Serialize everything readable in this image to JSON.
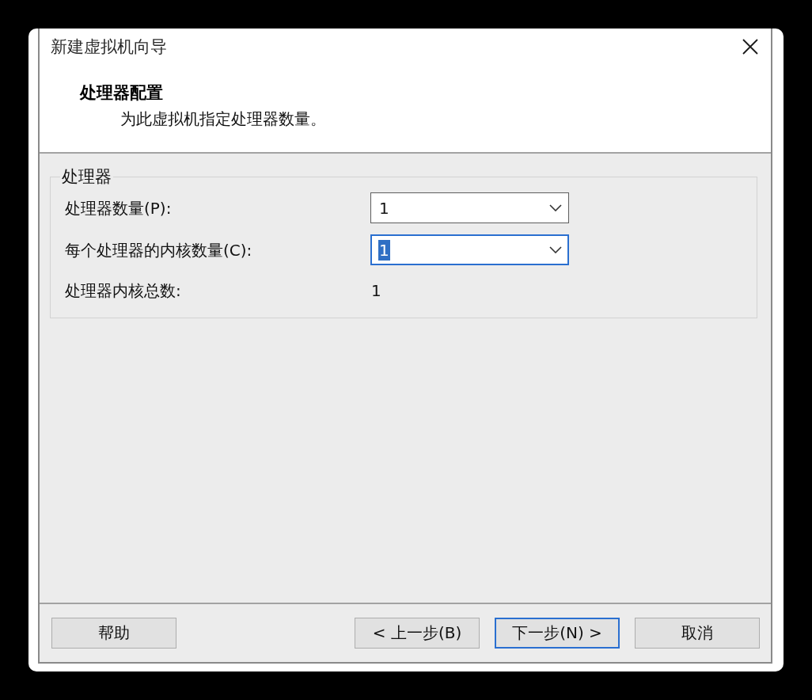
{
  "window": {
    "title": "新建虚拟机向导"
  },
  "header": {
    "title": "处理器配置",
    "subtitle": "为此虚拟机指定处理器数量。"
  },
  "group": {
    "legend": "处理器",
    "fields": [
      {
        "kind": "combo",
        "label": "处理器数量(P):",
        "value": "1",
        "focused": false
      },
      {
        "kind": "combo",
        "label": "每个处理器的内核数量(C):",
        "value": "1",
        "focused": true
      },
      {
        "kind": "text",
        "label": "处理器内核总数:",
        "value": "1"
      }
    ]
  },
  "buttons": [
    {
      "label": "帮助",
      "default": false
    },
    {
      "label": "< 上一步(B)",
      "default": false
    },
    {
      "label": "下一步(N) >",
      "default": true
    },
    {
      "label": "取消",
      "default": false
    }
  ]
}
